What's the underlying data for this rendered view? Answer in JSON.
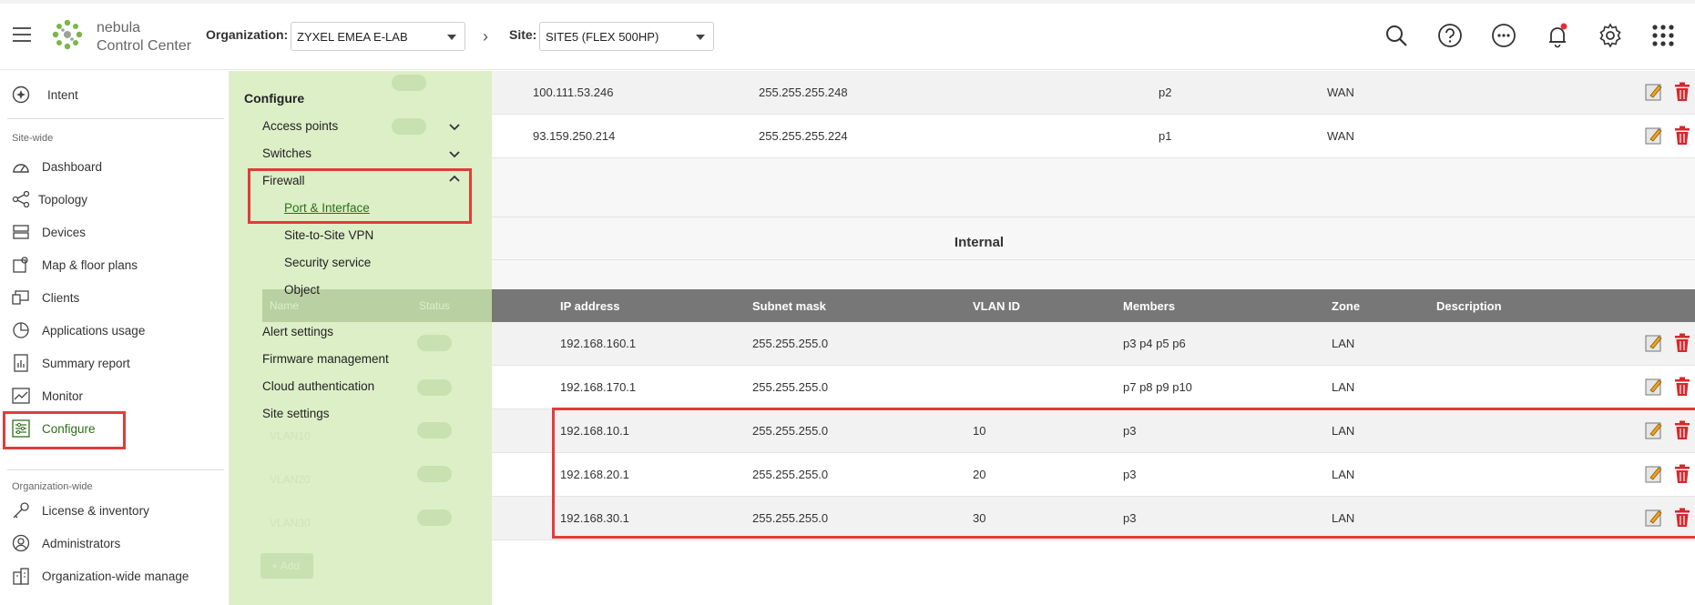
{
  "header": {
    "logo_line1": "nebula",
    "logo_line2": "Control Center",
    "org_label": "Organization:",
    "org_value": "ZYXEL EMEA E-LAB",
    "site_label": "Site:",
    "site_value": "SITE5 (FLEX 500HP)",
    "icons": [
      "search-icon",
      "help-icon",
      "more-icon",
      "notification-icon",
      "settings-icon",
      "apps-icon"
    ]
  },
  "sidebar": {
    "intent": "Intent",
    "site_wide_label": "Site-wide",
    "site_items": [
      "Dashboard",
      "Topology",
      "Devices",
      "Map & floor plans",
      "Clients",
      "Applications usage",
      "Summary report",
      "Monitor",
      "Configure"
    ],
    "org_wide_label": "Organization-wide",
    "org_items": [
      "License & inventory",
      "Administrators",
      "Organization-wide manage"
    ]
  },
  "flyout": {
    "title": "Configure",
    "items": {
      "access_points": "Access points",
      "switches": "Switches",
      "firewall": "Firewall",
      "port_interface": "Port & Interface",
      "site_to_site_vpn": "Site-to-Site VPN",
      "security_service": "Security service",
      "object": "Object",
      "alert_settings": "Alert settings",
      "firmware_management": "Firmware management",
      "cloud_authentication": "Cloud authentication",
      "site_settings": "Site settings"
    }
  },
  "ghost": {
    "name_header": "Name",
    "status_header": "Status",
    "vlan10": "VLAN10",
    "vlan20": "VLAN20",
    "vlan30": "VLAN30",
    "add": "+ Add"
  },
  "wan_rows": [
    {
      "ip": "100.111.53.246",
      "mask": "255.255.255.248",
      "members": "p2",
      "zone": "WAN"
    },
    {
      "ip": "93.159.250.214",
      "mask": "255.255.255.224",
      "members": "p1",
      "zone": "WAN"
    }
  ],
  "internal": {
    "title": "Internal",
    "columns": [
      "IP address",
      "Subnet mask",
      "VLAN ID",
      "Members",
      "Zone",
      "Description"
    ],
    "rows": [
      {
        "ip": "192.168.160.1",
        "mask": "255.255.255.0",
        "vlan": "",
        "members": "p3 p4 p5 p6",
        "zone": "LAN",
        "description": ""
      },
      {
        "ip": "192.168.170.1",
        "mask": "255.255.255.0",
        "vlan": "",
        "members": "p7 p8 p9 p10",
        "zone": "LAN",
        "description": ""
      },
      {
        "ip": "192.168.10.1",
        "mask": "255.255.255.0",
        "vlan": "10",
        "members": "p3",
        "zone": "LAN",
        "description": ""
      },
      {
        "ip": "192.168.20.1",
        "mask": "255.255.255.0",
        "vlan": "20",
        "members": "p3",
        "zone": "LAN",
        "description": ""
      },
      {
        "ip": "192.168.30.1",
        "mask": "255.255.255.0",
        "vlan": "30",
        "members": "p3",
        "zone": "LAN",
        "description": ""
      }
    ]
  },
  "colors": {
    "accent_green": "#2e6e1a",
    "flyout_bg": "#dcefc7",
    "highlight_red": "#e23b3b",
    "delete_red": "#d9262b",
    "table_header": "#777777"
  }
}
